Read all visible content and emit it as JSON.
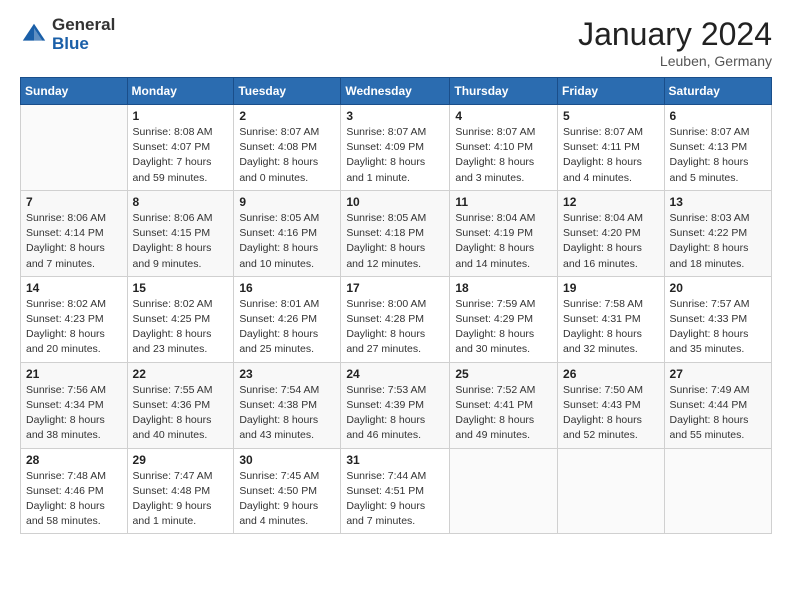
{
  "header": {
    "logo_general": "General",
    "logo_blue": "Blue",
    "month_title": "January 2024",
    "location": "Leuben, Germany"
  },
  "days_of_week": [
    "Sunday",
    "Monday",
    "Tuesday",
    "Wednesday",
    "Thursday",
    "Friday",
    "Saturday"
  ],
  "weeks": [
    [
      {
        "day": "",
        "info": ""
      },
      {
        "day": "1",
        "info": "Sunrise: 8:08 AM\nSunset: 4:07 PM\nDaylight: 7 hours\nand 59 minutes."
      },
      {
        "day": "2",
        "info": "Sunrise: 8:07 AM\nSunset: 4:08 PM\nDaylight: 8 hours\nand 0 minutes."
      },
      {
        "day": "3",
        "info": "Sunrise: 8:07 AM\nSunset: 4:09 PM\nDaylight: 8 hours\nand 1 minute."
      },
      {
        "day": "4",
        "info": "Sunrise: 8:07 AM\nSunset: 4:10 PM\nDaylight: 8 hours\nand 3 minutes."
      },
      {
        "day": "5",
        "info": "Sunrise: 8:07 AM\nSunset: 4:11 PM\nDaylight: 8 hours\nand 4 minutes."
      },
      {
        "day": "6",
        "info": "Sunrise: 8:07 AM\nSunset: 4:13 PM\nDaylight: 8 hours\nand 5 minutes."
      }
    ],
    [
      {
        "day": "7",
        "info": "Sunrise: 8:06 AM\nSunset: 4:14 PM\nDaylight: 8 hours\nand 7 minutes."
      },
      {
        "day": "8",
        "info": "Sunrise: 8:06 AM\nSunset: 4:15 PM\nDaylight: 8 hours\nand 9 minutes."
      },
      {
        "day": "9",
        "info": "Sunrise: 8:05 AM\nSunset: 4:16 PM\nDaylight: 8 hours\nand 10 minutes."
      },
      {
        "day": "10",
        "info": "Sunrise: 8:05 AM\nSunset: 4:18 PM\nDaylight: 8 hours\nand 12 minutes."
      },
      {
        "day": "11",
        "info": "Sunrise: 8:04 AM\nSunset: 4:19 PM\nDaylight: 8 hours\nand 14 minutes."
      },
      {
        "day": "12",
        "info": "Sunrise: 8:04 AM\nSunset: 4:20 PM\nDaylight: 8 hours\nand 16 minutes."
      },
      {
        "day": "13",
        "info": "Sunrise: 8:03 AM\nSunset: 4:22 PM\nDaylight: 8 hours\nand 18 minutes."
      }
    ],
    [
      {
        "day": "14",
        "info": "Sunrise: 8:02 AM\nSunset: 4:23 PM\nDaylight: 8 hours\nand 20 minutes."
      },
      {
        "day": "15",
        "info": "Sunrise: 8:02 AM\nSunset: 4:25 PM\nDaylight: 8 hours\nand 23 minutes."
      },
      {
        "day": "16",
        "info": "Sunrise: 8:01 AM\nSunset: 4:26 PM\nDaylight: 8 hours\nand 25 minutes."
      },
      {
        "day": "17",
        "info": "Sunrise: 8:00 AM\nSunset: 4:28 PM\nDaylight: 8 hours\nand 27 minutes."
      },
      {
        "day": "18",
        "info": "Sunrise: 7:59 AM\nSunset: 4:29 PM\nDaylight: 8 hours\nand 30 minutes."
      },
      {
        "day": "19",
        "info": "Sunrise: 7:58 AM\nSunset: 4:31 PM\nDaylight: 8 hours\nand 32 minutes."
      },
      {
        "day": "20",
        "info": "Sunrise: 7:57 AM\nSunset: 4:33 PM\nDaylight: 8 hours\nand 35 minutes."
      }
    ],
    [
      {
        "day": "21",
        "info": "Sunrise: 7:56 AM\nSunset: 4:34 PM\nDaylight: 8 hours\nand 38 minutes."
      },
      {
        "day": "22",
        "info": "Sunrise: 7:55 AM\nSunset: 4:36 PM\nDaylight: 8 hours\nand 40 minutes."
      },
      {
        "day": "23",
        "info": "Sunrise: 7:54 AM\nSunset: 4:38 PM\nDaylight: 8 hours\nand 43 minutes."
      },
      {
        "day": "24",
        "info": "Sunrise: 7:53 AM\nSunset: 4:39 PM\nDaylight: 8 hours\nand 46 minutes."
      },
      {
        "day": "25",
        "info": "Sunrise: 7:52 AM\nSunset: 4:41 PM\nDaylight: 8 hours\nand 49 minutes."
      },
      {
        "day": "26",
        "info": "Sunrise: 7:50 AM\nSunset: 4:43 PM\nDaylight: 8 hours\nand 52 minutes."
      },
      {
        "day": "27",
        "info": "Sunrise: 7:49 AM\nSunset: 4:44 PM\nDaylight: 8 hours\nand 55 minutes."
      }
    ],
    [
      {
        "day": "28",
        "info": "Sunrise: 7:48 AM\nSunset: 4:46 PM\nDaylight: 8 hours\nand 58 minutes."
      },
      {
        "day": "29",
        "info": "Sunrise: 7:47 AM\nSunset: 4:48 PM\nDaylight: 9 hours\nand 1 minute."
      },
      {
        "day": "30",
        "info": "Sunrise: 7:45 AM\nSunset: 4:50 PM\nDaylight: 9 hours\nand 4 minutes."
      },
      {
        "day": "31",
        "info": "Sunrise: 7:44 AM\nSunset: 4:51 PM\nDaylight: 9 hours\nand 7 minutes."
      },
      {
        "day": "",
        "info": ""
      },
      {
        "day": "",
        "info": ""
      },
      {
        "day": "",
        "info": ""
      }
    ]
  ]
}
